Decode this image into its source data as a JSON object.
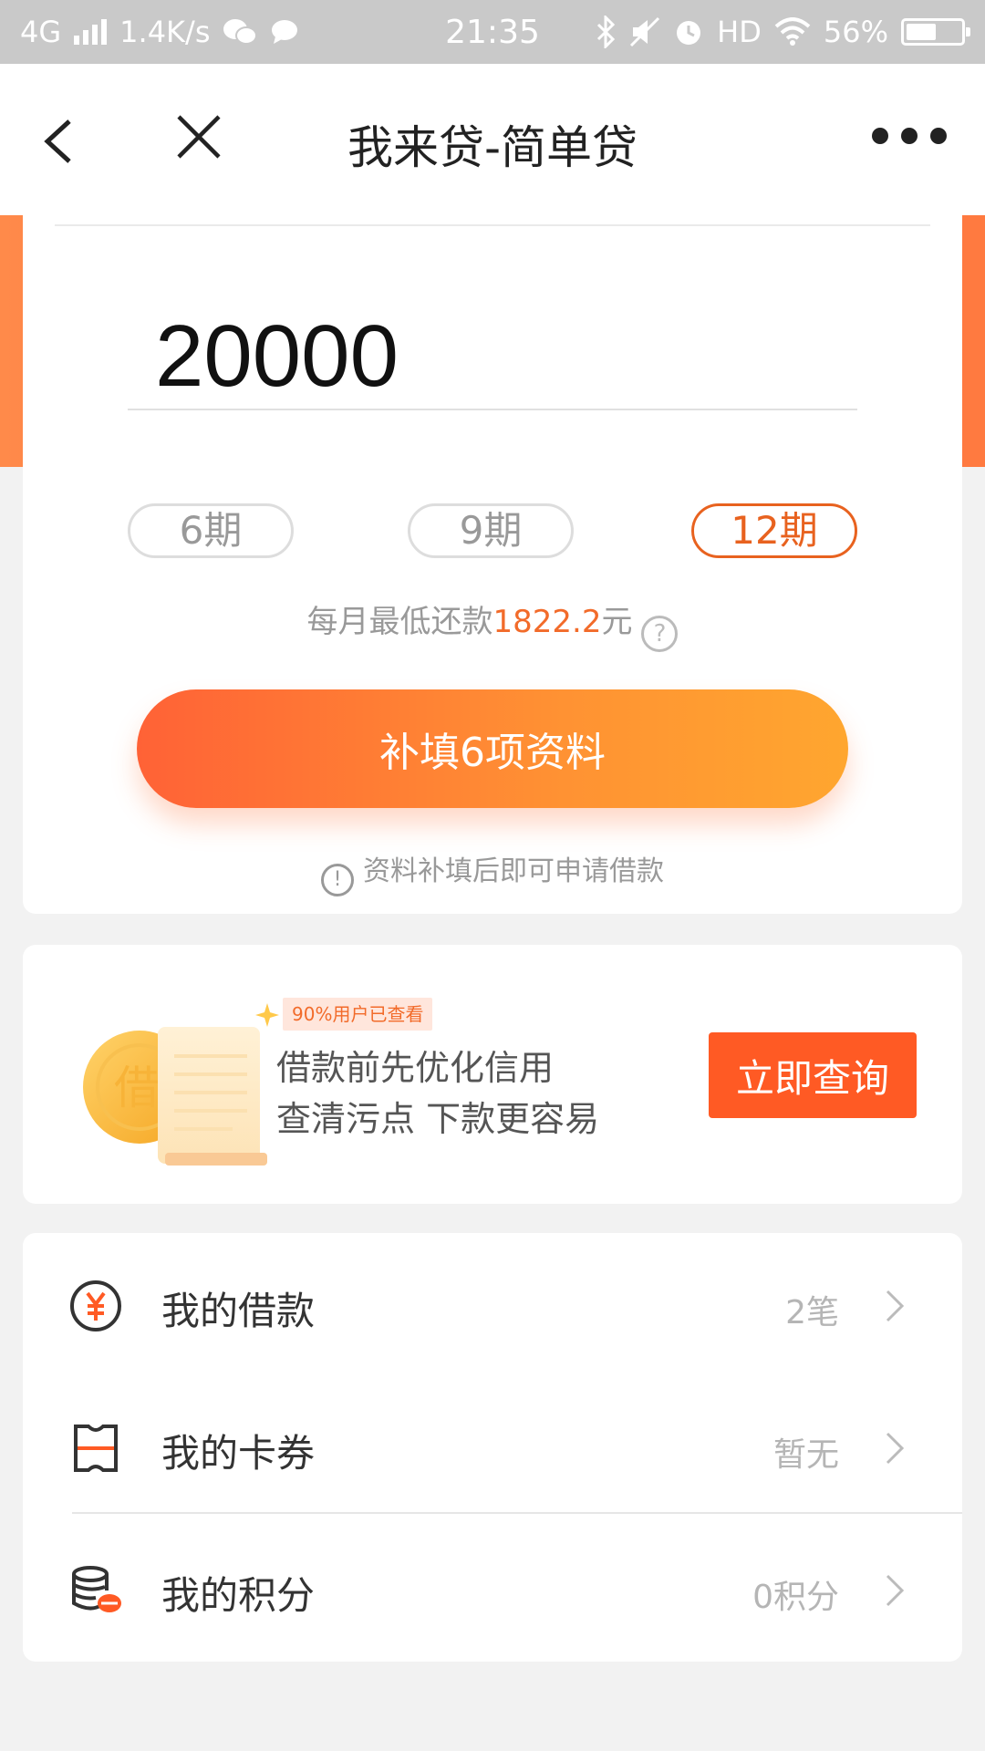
{
  "status_bar": {
    "network": "4G",
    "speed": "1.4K/s",
    "time": "21:35",
    "hd": "HD",
    "battery": "56%",
    "battery_level": 0.56
  },
  "nav": {
    "title": "我来贷-简单贷"
  },
  "loan": {
    "amount": "20000",
    "periods": [
      {
        "label": "6期",
        "selected": false
      },
      {
        "label": "9期",
        "selected": false
      },
      {
        "label": "12期",
        "selected": true
      }
    ],
    "monthly_prefix": "每月最低还款",
    "monthly_amount": "1822.2",
    "monthly_suffix": "元",
    "help_glyph": "?",
    "button_label": "补填6项资料",
    "notice_glyph": "!",
    "notice_text": "资料补填后即可申请借款"
  },
  "credit": {
    "coin_char": "借",
    "badge": "90%用户已查看",
    "line1": "借款前先优化信用",
    "line2": "查清污点 下款更容易",
    "button_label": "立即查询"
  },
  "menu": [
    {
      "label": "我的借款",
      "value": "2笔",
      "icon": "yuan-circle-icon"
    },
    {
      "label": "我的卡券",
      "value": "暂无",
      "icon": "ticket-icon"
    },
    {
      "label": "我的积分",
      "value": "0积分",
      "icon": "coins-stack-icon"
    }
  ],
  "colors": {
    "accent": "#f26b2a",
    "button_gradient_start": "#ff6236",
    "button_gradient_end": "#ffa62f",
    "query_button": "#ff5a24"
  }
}
